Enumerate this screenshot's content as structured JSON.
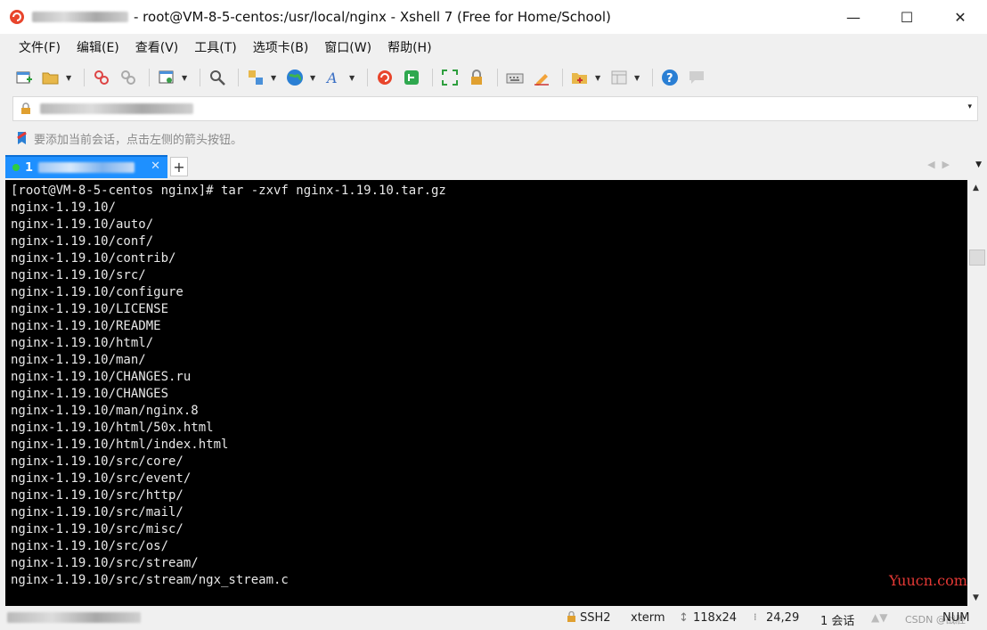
{
  "window": {
    "title": "- root@VM-8-5-centos:/usr/local/nginx - Xshell 7 (Free for Home/School)",
    "controls": {
      "minimize": "—",
      "maximize": "☐",
      "close": "✕"
    }
  },
  "menu": [
    "文件(F)",
    "编辑(E)",
    "查看(V)",
    "工具(T)",
    "选项卡(B)",
    "窗口(W)",
    "帮助(H)"
  ],
  "toolbar": {
    "icons": [
      "new-session-icon",
      "open-folder-icon",
      "disconnect-icon",
      "reconnect-icon",
      "properties-icon",
      "search-icon",
      "transfer-icon",
      "globe-icon",
      "font-icon",
      "xshell-icon",
      "xftp-icon",
      "fullscreen-icon",
      "lock-icon",
      "keyboard-icon",
      "highlight-icon",
      "compose-icon",
      "layout-icon",
      "help-icon",
      "chat-icon"
    ]
  },
  "address_bar": {
    "dropdown": "▾"
  },
  "hint": {
    "text": "要添加当前会话，点击左侧的箭头按钮。"
  },
  "tabs": [
    {
      "number": "1",
      "close": "✕"
    }
  ],
  "tab_add": "+",
  "terminal": {
    "lines": [
      "[root@VM-8-5-centos nginx]# tar -zxvf nginx-1.19.10.tar.gz",
      "nginx-1.19.10/",
      "nginx-1.19.10/auto/",
      "nginx-1.19.10/conf/",
      "nginx-1.19.10/contrib/",
      "nginx-1.19.10/src/",
      "nginx-1.19.10/configure",
      "nginx-1.19.10/LICENSE",
      "nginx-1.19.10/README",
      "nginx-1.19.10/html/",
      "nginx-1.19.10/man/",
      "nginx-1.19.10/CHANGES.ru",
      "nginx-1.19.10/CHANGES",
      "nginx-1.19.10/man/nginx.8",
      "nginx-1.19.10/html/50x.html",
      "nginx-1.19.10/html/index.html",
      "nginx-1.19.10/src/core/",
      "nginx-1.19.10/src/event/",
      "nginx-1.19.10/src/http/",
      "nginx-1.19.10/src/mail/",
      "nginx-1.19.10/src/misc/",
      "nginx-1.19.10/src/os/",
      "nginx-1.19.10/src/stream/",
      "nginx-1.19.10/src/stream/ngx_stream.c"
    ]
  },
  "watermark": "Yuucn.com",
  "status": {
    "protocol": "SSH2",
    "terminal_type": "xterm",
    "size": "118x24",
    "cursor": "24,29",
    "sessions": "1 会话",
    "num": "NUM",
    "csdn": "CSDN @战胜"
  }
}
